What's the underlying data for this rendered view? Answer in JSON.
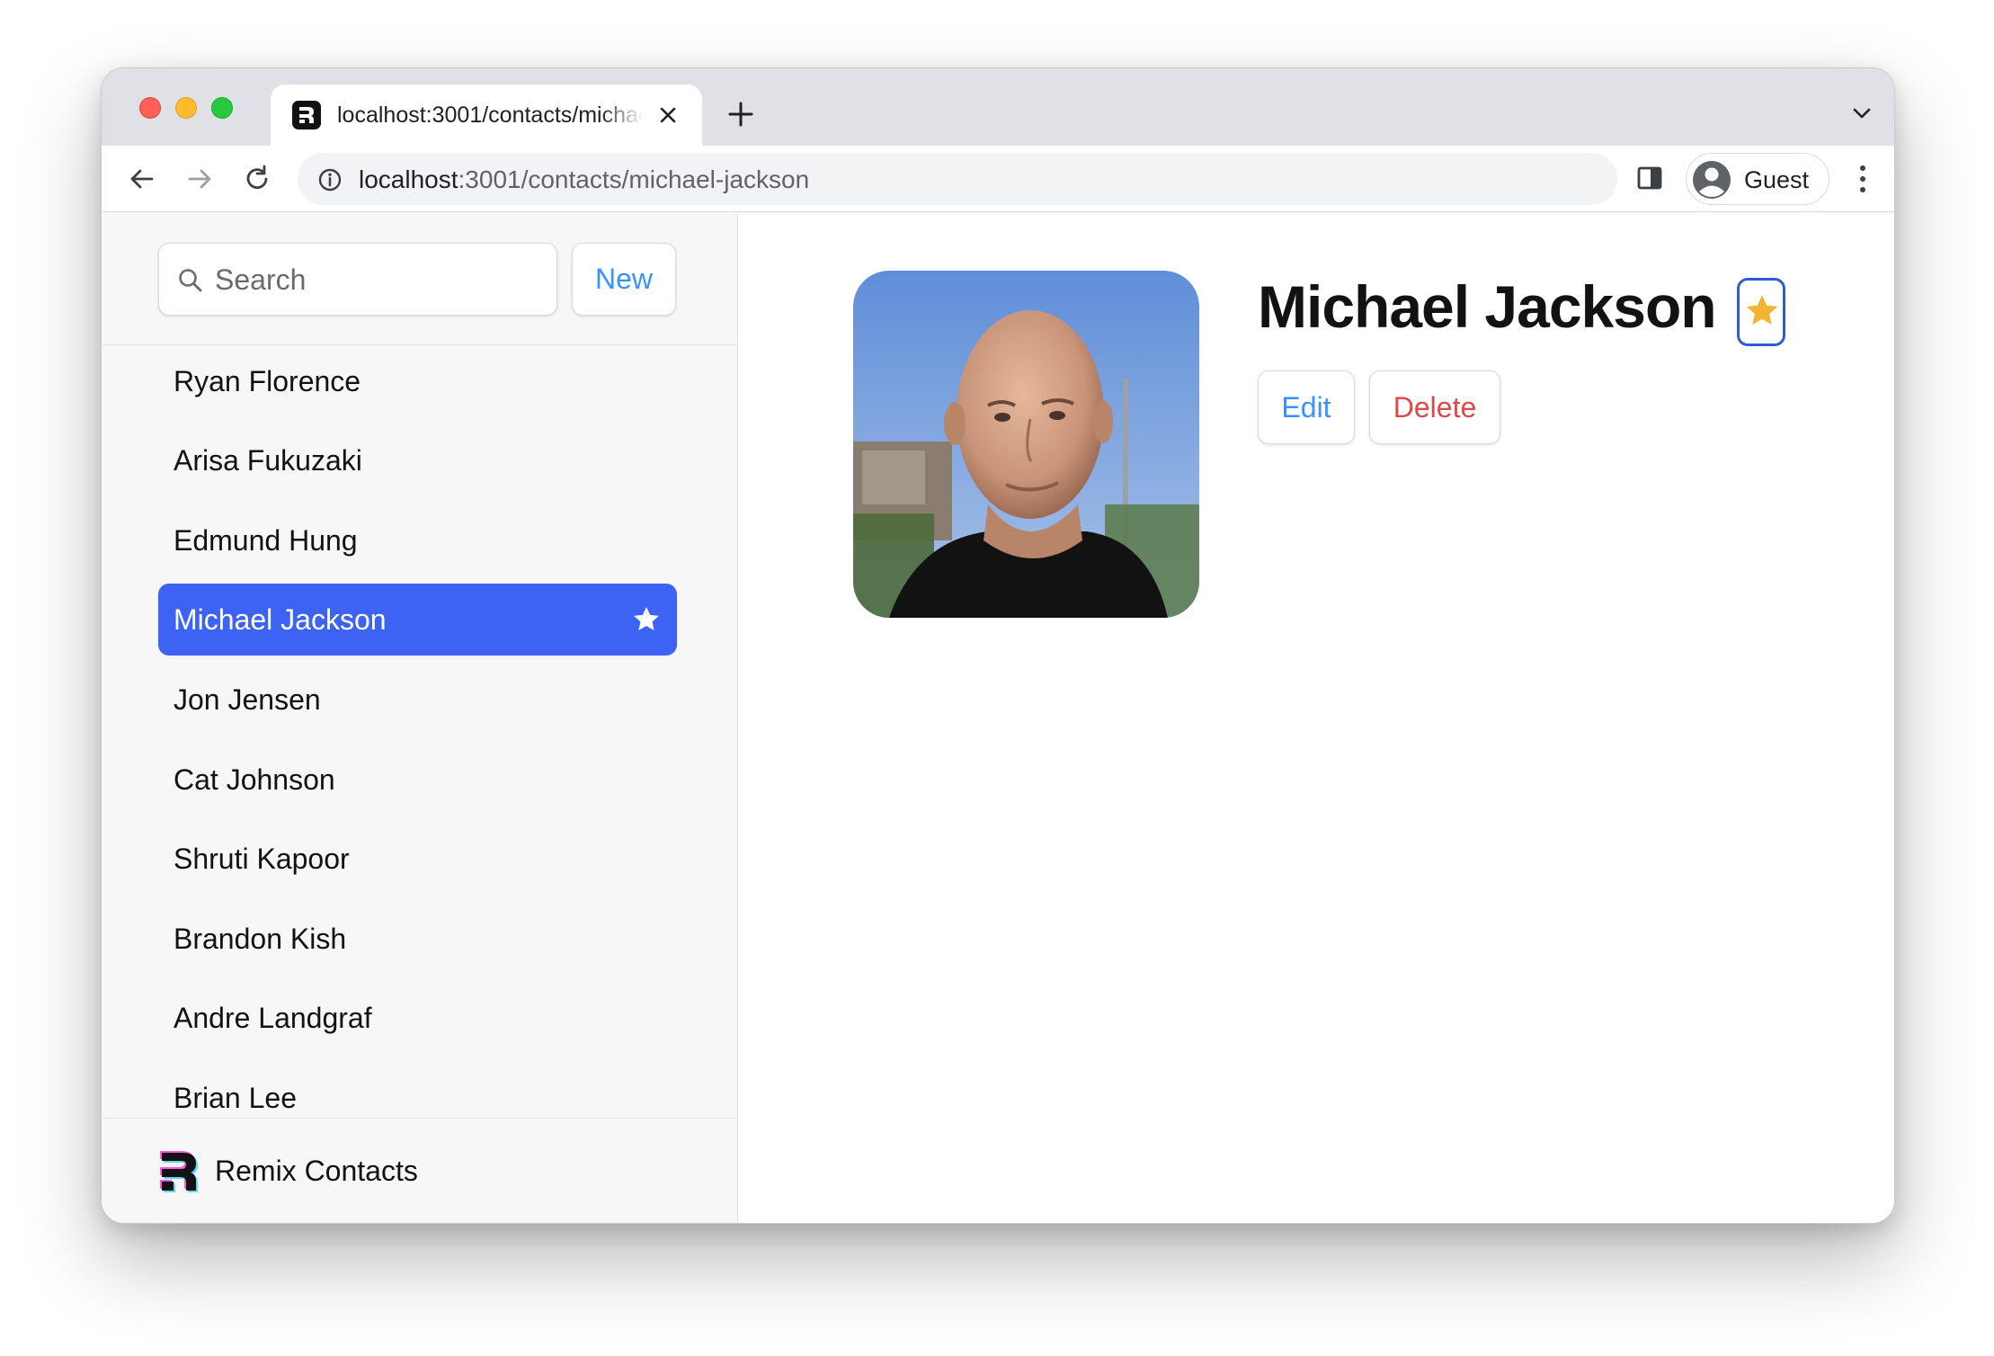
{
  "browser": {
    "tab_title": "localhost:3001/contacts/michael-jackson",
    "url_host": "localhost",
    "url_path": ":3001/contacts/michael-jackson",
    "profile_name": "Guest"
  },
  "sidebar": {
    "search_placeholder": "Search",
    "new_label": "New",
    "contacts": [
      {
        "name": "Ryan Florence",
        "favorite": false,
        "active": false
      },
      {
        "name": "Arisa Fukuzaki",
        "favorite": false,
        "active": false
      },
      {
        "name": "Edmund Hung",
        "favorite": false,
        "active": false
      },
      {
        "name": "Michael Jackson",
        "favorite": true,
        "active": true
      },
      {
        "name": "Jon Jensen",
        "favorite": false,
        "active": false
      },
      {
        "name": "Cat Johnson",
        "favorite": false,
        "active": false
      },
      {
        "name": "Shruti Kapoor",
        "favorite": false,
        "active": false
      },
      {
        "name": "Brandon Kish",
        "favorite": false,
        "active": false
      },
      {
        "name": "Andre Landgraf",
        "favorite": false,
        "active": false
      },
      {
        "name": "Brian Lee",
        "favorite": false,
        "active": false
      }
    ],
    "footer_brand": "Remix Contacts"
  },
  "contact": {
    "name": "Michael Jackson",
    "favorite": true,
    "edit_label": "Edit",
    "delete_label": "Delete"
  },
  "colors": {
    "accent": "#3992ff",
    "active_item": "#3d63f5",
    "danger": "#e04848",
    "star": "#f2b533"
  }
}
